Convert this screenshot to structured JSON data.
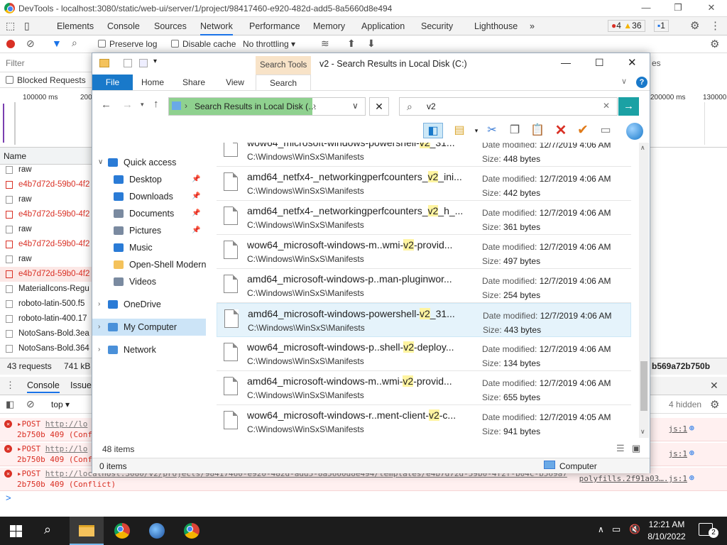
{
  "devtools": {
    "title": "DevTools - localhost:3080/static/web-ui/server/1/project/98417460-e920-482d-add5-8a5660d8e494",
    "tabs": [
      "Elements",
      "Console",
      "Sources",
      "Network",
      "Performance",
      "Memory",
      "Application",
      "Security",
      "Lighthouse"
    ],
    "active_tab": "Network",
    "more_tabs": "»",
    "errors": "4",
    "warnings": "36",
    "messages": "1",
    "toolbar": {
      "preserve_log": "Preserve log",
      "disable_cache": "Disable cache",
      "throttling": "No throttling"
    },
    "filter_placeholder": "Filter",
    "blocked_requests": "Blocked Requests",
    "timeline_ticks": [
      "100000 ms",
      "200",
      "200000 ms",
      "130000"
    ],
    "name_header": "Name",
    "requests": [
      {
        "name": "raw",
        "error": false,
        "selected": false
      },
      {
        "name": "e4b7d72d-59b0-4f2",
        "error": true,
        "selected": false
      },
      {
        "name": "raw",
        "error": false,
        "selected": false
      },
      {
        "name": "e4b7d72d-59b0-4f2",
        "error": true,
        "selected": false
      },
      {
        "name": "raw",
        "error": false,
        "selected": false
      },
      {
        "name": "e4b7d72d-59b0-4f2",
        "error": true,
        "selected": false
      },
      {
        "name": "raw",
        "error": false,
        "selected": false
      },
      {
        "name": "e4b7d72d-59b0-4f2",
        "error": true,
        "selected": true
      },
      {
        "name": "MaterialIcons-Regu",
        "error": false,
        "selected": false
      },
      {
        "name": "roboto-latin-500.f5",
        "error": false,
        "selected": false
      },
      {
        "name": "roboto-latin-400.17",
        "error": false,
        "selected": false
      },
      {
        "name": "NotoSans-Bold.3ea",
        "error": false,
        "selected": false
      },
      {
        "name": "NotoSans-Bold.364",
        "error": false,
        "selected": false
      }
    ],
    "status": {
      "requests": "43 requests",
      "transferred": "741 kB",
      "hash": "b569a72b750b"
    },
    "console_tabs": [
      "Console",
      "Issues"
    ],
    "console_context": "top",
    "hidden_count": "4 hidden",
    "console_lines": [
      {
        "method": "POST",
        "url": "http://lo",
        "status": "2b750b 409 (Conf",
        "source": "js:1"
      },
      {
        "method": "POST",
        "url": "http://lo",
        "status": "2b750b 409 (Conf",
        "source": "js:1"
      },
      {
        "method": "POST",
        "url": "http://localhost:3080/v2/projects/98417460-e920-482d-add5-8a5660d8e494/templates/e4b7d72d-59b0-4f2f-b04c-b569a7",
        "status": "2b750b 409 (Conflict)",
        "source": "polyfills.2f91a03….js:1"
      }
    ],
    "prompt": ">"
  },
  "explorer": {
    "title": "v2 - Search Results in Local Disk (C:)",
    "search_tools_label": "Search Tools",
    "ribbon_tabs": [
      "File",
      "Home",
      "Share",
      "View",
      "Search"
    ],
    "address": "Search Results in Local Disk (…",
    "search_value": "v2",
    "nav_items": [
      {
        "label": "Quick access",
        "icon": "star-icon",
        "level": 0,
        "pinned": false
      },
      {
        "label": "Desktop",
        "icon": "desktop-icon",
        "level": 1,
        "pinned": true
      },
      {
        "label": "Downloads",
        "icon": "downloads-icon",
        "level": 1,
        "pinned": true
      },
      {
        "label": "Documents",
        "icon": "documents-icon",
        "level": 1,
        "pinned": true
      },
      {
        "label": "Pictures",
        "icon": "pictures-icon",
        "level": 1,
        "pinned": true
      },
      {
        "label": "Music",
        "icon": "music-icon",
        "level": 1,
        "pinned": false
      },
      {
        "label": "Open-Shell Modern",
        "icon": "folder-icon",
        "level": 1,
        "pinned": false
      },
      {
        "label": "Videos",
        "icon": "videos-icon",
        "level": 1,
        "pinned": false
      },
      {
        "label": "OneDrive",
        "icon": "cloud-icon",
        "level": 0,
        "pinned": false
      },
      {
        "label": "My Computer",
        "icon": "computer-icon",
        "level": 0,
        "pinned": false
      },
      {
        "label": "Network",
        "icon": "network-icon",
        "level": 0,
        "pinned": false
      }
    ],
    "files": [
      {
        "pre": "wow64_microsoft-windows-powershell-",
        "hl": "v2",
        "post": "_31...",
        "path": "C:\\Windows\\WinSxS\\Manifests",
        "date": "12/7/2019 4:06 AM",
        "size": "448 bytes",
        "selected": false
      },
      {
        "pre": "amd64_netfx4-_networkingperfcounters_",
        "hl": "v2",
        "post": "_ini...",
        "path": "C:\\Windows\\WinSxS\\Manifests",
        "date": "12/7/2019 4:06 AM",
        "size": "442 bytes",
        "selected": false
      },
      {
        "pre": "amd64_netfx4-_networkingperfcounters_",
        "hl": "v2",
        "post": "_h_...",
        "path": "C:\\Windows\\WinSxS\\Manifests",
        "date": "12/7/2019 4:06 AM",
        "size": "361 bytes",
        "selected": false
      },
      {
        "pre": "wow64_microsoft-windows-m..wmi-",
        "hl": "v2",
        "post": "-provid...",
        "path": "C:\\Windows\\WinSxS\\Manifests",
        "date": "12/7/2019 4:06 AM",
        "size": "497 bytes",
        "selected": false
      },
      {
        "pre": "amd64_microsoft-windows-p..man-pluginwor...",
        "hl": "",
        "post": "",
        "path": "C:\\Windows\\WinSxS\\Manifests",
        "date": "12/7/2019 4:06 AM",
        "size": "254 bytes",
        "selected": false
      },
      {
        "pre": "amd64_microsoft-windows-powershell-",
        "hl": "v2",
        "post": "_31...",
        "path": "C:\\Windows\\WinSxS\\Manifests",
        "date": "12/7/2019 4:06 AM",
        "size": "443 bytes",
        "selected": true
      },
      {
        "pre": "wow64_microsoft-windows-p..shell-",
        "hl": "v2",
        "post": "-deploy...",
        "path": "C:\\Windows\\WinSxS\\Manifests",
        "date": "12/7/2019 4:06 AM",
        "size": "134 bytes",
        "selected": false
      },
      {
        "pre": "amd64_microsoft-windows-m..wmi-",
        "hl": "v2",
        "post": "-provid...",
        "path": "C:\\Windows\\WinSxS\\Manifests",
        "date": "12/7/2019 4:06 AM",
        "size": "655 bytes",
        "selected": false
      },
      {
        "pre": "wow64_microsoft-windows-r..ment-client-",
        "hl": "v2",
        "post": "-c...",
        "path": "C:\\Windows\\WinSxS\\Manifests",
        "date": "12/7/2019 4:05 AM",
        "size": "941 bytes",
        "selected": false
      }
    ],
    "date_label": "Date modified:",
    "size_label": "Size:",
    "item_count": "48 items",
    "selection_count": "0 items",
    "location": "Computer"
  },
  "taskbar": {
    "time": "12:21 AM",
    "date": "8/10/2022",
    "notifications": "2"
  },
  "colors": {
    "accent": "#1979ca",
    "highlight": "#fff4a0",
    "selected_row": "#e5f3fb",
    "taskbar": "#1c1c1c",
    "error": "#d93025"
  }
}
